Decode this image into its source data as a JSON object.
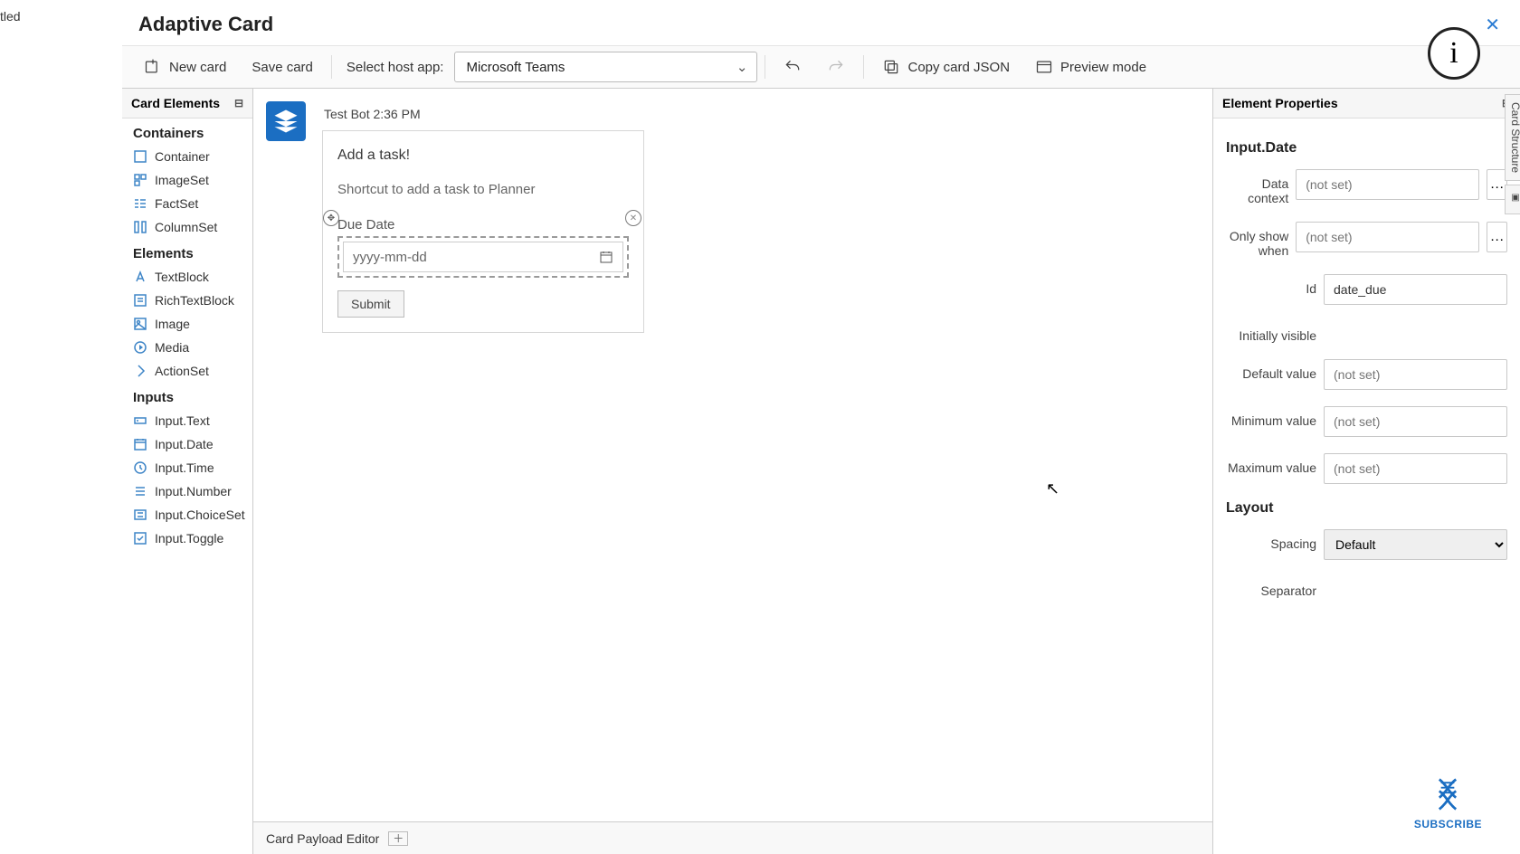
{
  "stray_tab": "tled",
  "title": "Adaptive Card",
  "toolbar": {
    "new_card": "New card",
    "save_card": "Save card",
    "host_label": "Select host app:",
    "host_value": "Microsoft Teams",
    "copy_json": "Copy card JSON",
    "preview": "Preview mode"
  },
  "left": {
    "title": "Card Elements",
    "groups": [
      {
        "name": "Containers",
        "items": [
          "Container",
          "ImageSet",
          "FactSet",
          "ColumnSet"
        ]
      },
      {
        "name": "Elements",
        "items": [
          "TextBlock",
          "RichTextBlock",
          "Image",
          "Media",
          "ActionSet"
        ]
      },
      {
        "name": "Inputs",
        "items": [
          "Input.Text",
          "Input.Date",
          "Input.Time",
          "Input.Number",
          "Input.ChoiceSet",
          "Input.Toggle"
        ]
      }
    ]
  },
  "canvas": {
    "bot_line": "Test Bot 2:36 PM",
    "card_title": "Add a task!",
    "card_subtitle": "Shortcut to add a task to Planner",
    "due_label": "Due Date",
    "date_placeholder": "yyyy-mm-dd",
    "submit": "Submit",
    "payload_title": "Card Payload Editor"
  },
  "right": {
    "title": "Element Properties",
    "element_type": "Input.Date",
    "rows": {
      "data_context": {
        "label": "Data context",
        "value": "(not set)"
      },
      "only_show_when": {
        "label": "Only show when",
        "value": "(not set)"
      },
      "id": {
        "label": "Id",
        "value": "date_due"
      },
      "initially_visible": {
        "label": "Initially visible",
        "value": ""
      },
      "default_value": {
        "label": "Default value",
        "value": "(not set)"
      },
      "min_value": {
        "label": "Minimum value",
        "value": "(not set)"
      },
      "max_value": {
        "label": "Maximum value",
        "value": "(not set)"
      }
    },
    "layout_title": "Layout",
    "spacing_label": "Spacing",
    "spacing_value": "Default",
    "separator_label": "Separator"
  },
  "side_tabs": {
    "structure": "Card Structure"
  },
  "subscribe": "SUBSCRIBE"
}
